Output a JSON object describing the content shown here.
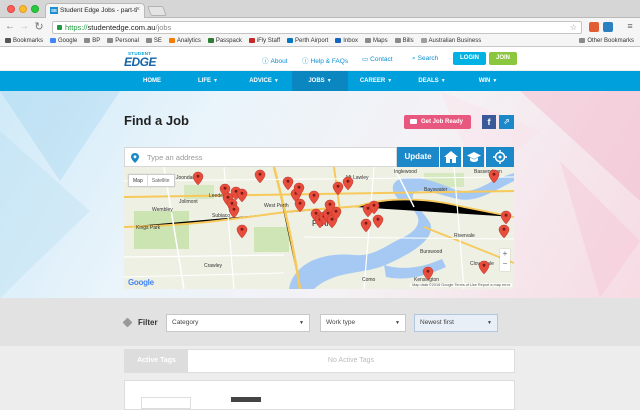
{
  "browser": {
    "tab_title": "Student Edge Jobs - part-ti",
    "favicon_label": "SE",
    "url_scheme": "https://",
    "url_host": "studentedge.com.au",
    "url_path": "/jobs",
    "bookmarks": [
      {
        "label": "Bookmarks",
        "icon": "bookmarks-icon",
        "color": "#555555"
      },
      {
        "label": "Google",
        "icon": "google-icon",
        "color": "#4285f4"
      },
      {
        "label": "BP",
        "icon": "folder-icon",
        "color": "#8a8a8a"
      },
      {
        "label": "Personal",
        "icon": "folder-icon",
        "color": "#8a8a8a"
      },
      {
        "label": "SE",
        "icon": "folder-icon",
        "color": "#8a8a8a"
      },
      {
        "label": "Analytics",
        "icon": "analytics-icon",
        "color": "#f57c00"
      },
      {
        "label": "Passpack",
        "icon": "passpack-icon",
        "color": "#2e7d32"
      },
      {
        "label": "iFly Staff",
        "icon": "ifly-icon",
        "color": "#c62828"
      },
      {
        "label": "Perth Airport",
        "icon": "airport-icon",
        "color": "#0277bd"
      },
      {
        "label": "Inbox",
        "icon": "mail-icon",
        "color": "#1565c0"
      },
      {
        "label": "Maps",
        "icon": "folder-icon",
        "color": "#8a8a8a"
      },
      {
        "label": "Bills",
        "icon": "folder-icon",
        "color": "#8a8a8a"
      },
      {
        "label": "Australian Business",
        "icon": "document-icon",
        "color": "#9e9e9e"
      }
    ],
    "other_bookmarks": "Other Bookmarks"
  },
  "header": {
    "logo_top": "STUDENT",
    "logo_main": "EDGE",
    "about": "About",
    "help": "Help & FAQs",
    "contact": "Contact",
    "search": "Search",
    "login": "LOGIN",
    "join": "JOIN"
  },
  "nav": {
    "items": [
      {
        "label": "HOME",
        "caret": false,
        "active": false
      },
      {
        "label": "LIFE",
        "caret": true,
        "active": false
      },
      {
        "label": "ADVICE",
        "caret": true,
        "active": false
      },
      {
        "label": "JOBS",
        "caret": true,
        "active": true
      },
      {
        "label": "CAREER",
        "caret": true,
        "active": false
      },
      {
        "label": "DEALS",
        "caret": true,
        "active": false
      },
      {
        "label": "WIN",
        "caret": true,
        "active": false
      }
    ]
  },
  "jobs": {
    "title": "Find a Job",
    "get_job_ready": "Get Job Ready",
    "facebook": "f",
    "address_placeholder": "Type an address",
    "update": "Update"
  },
  "map": {
    "toggle_map": "Map",
    "toggle_satellite": "Satellite",
    "city": "Perth",
    "labels": {
      "joondanna": "Joondanna",
      "mt_lawley": "Mt Lawley",
      "inglewood": "Inglewood",
      "bayswater": "Bayswater",
      "bassendean": "Bassendean",
      "jolimont": "Jolimont",
      "wembley": "Wembley",
      "west_perth": "West Perth",
      "rivervale": "Rivervale",
      "burswood": "Burswood",
      "cloverdale": "Cloverdale",
      "kensington": "Kensington",
      "como": "Como",
      "kings_park": "Kings Park",
      "leederville": "Leederville",
      "subiaco": "Subiaco",
      "crawley": "Crawley"
    },
    "zoom_in": "+",
    "zoom_out": "−",
    "google": "Google",
    "attribution": "Map data ©2016 Google   Terms of Use   Report a map error",
    "pin_color": "#e74c3c"
  },
  "filter": {
    "label": "Filter",
    "category": "Category",
    "work_type": "Work type",
    "sort": "Newest first"
  },
  "tags": {
    "active_tags": "Active Tags",
    "no_active": "No Active Tags"
  }
}
